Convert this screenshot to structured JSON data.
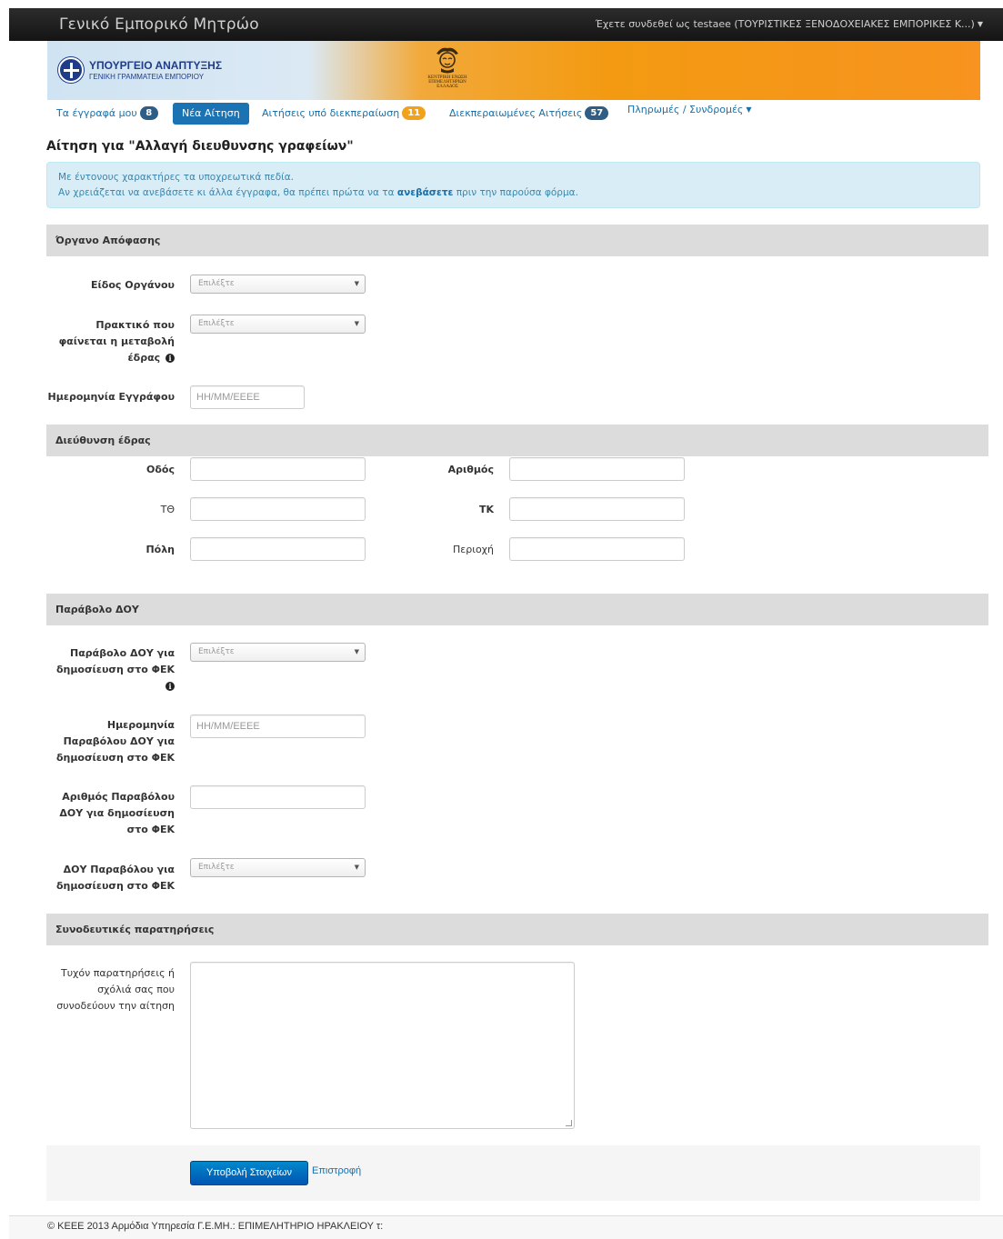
{
  "topbar": {
    "brand": "Γενικό Εμπορικό Μητρώο",
    "user": "Έχετε συνδεθεί ως testaee (ΤΟΥΡΙΣΤΙΚΕΣ ΞΕΝΟΔΟΧΕΙΑΚΕΣ ΕΜΠΟΡΙΚΕΣ Κ...)"
  },
  "banner": {
    "ministry_line1": "ΥΠΟΥΡΓΕΙΟ ΑΝΑΠΤΥΞΗΣ",
    "ministry_line2": "ΓΕΝΙΚΗ ΓΡΑΜΜΑΤΕΙΑ ΕΜΠΟΡΙΟΥ",
    "keee_line1": "ΚΕΝΤΡΙΚΗ ΕΝΩΣΗ",
    "keee_line2": "ΕΠΙΜΕΛΗΤΗΡΙΩΝ",
    "keee_line3": "ΕΛΛΑΔΟΣ"
  },
  "nav": {
    "my_docs": "Τα έγγραφά μου",
    "my_docs_count": "8",
    "new_request": "Νέα Αίτηση",
    "in_progress": "Αιτήσεις υπό διεκπεραίωση",
    "in_progress_count": "11",
    "completed": "Διεκπεραιωμένες Αιτήσεις",
    "completed_count": "57",
    "payments": "Πληρωμές / Συνδρομές"
  },
  "page": {
    "title": "Αίτηση για \"Αλλαγή διευθυνσης γραφείων\"",
    "alert_line1": "Με έντονους χαρακτήρες τα υποχρεωτικά πεδία.",
    "alert_line2_pre": "Αν χρειάζεται να ανεβάσετε κι άλλα έγγραφα, θα πρέπει πρώτα να τα ",
    "alert_link": "ανεβάσετε",
    "alert_line2_post": " πριν την παρούσα φόρμα."
  },
  "section_decision": {
    "header": "Όργανο Απόφασης",
    "organ_type_label": "Είδος Οργάνου",
    "organ_type_value": "Επιλέξτε",
    "minutes_label_1": "Πρακτικό που",
    "minutes_label_2": "φαίνεται η μεταβολή",
    "minutes_label_3": "έδρας",
    "minutes_value": "Επιλέξτε",
    "doc_date_label": "Ημερομηνία Εγγράφου",
    "doc_date_placeholder": "ΗΗ/ΜΜ/ΕΕΕΕ"
  },
  "section_address": {
    "header": "Διεύθυνση έδρας",
    "street_label": "Οδός",
    "number_label": "Αριθμός",
    "po_box_label": "ΤΘ",
    "postcode_label": "ΤΚ",
    "city_label": "Πόλη",
    "area_label": "Περιοχή"
  },
  "section_fee": {
    "header": "Παράβολο ΔΟΥ",
    "fee_label_1": "Παράβολο ΔΟΥ για",
    "fee_label_2": "δημοσίευση στο ΦΕΚ",
    "fee_value": "Επιλέξτε",
    "fee_date_label_1": "Ημερομηνία",
    "fee_date_label_2": "Παραβόλου ΔΟΥ για",
    "fee_date_label_3": "δημοσίευση στο ΦΕΚ",
    "fee_date_placeholder": "ΗΗ/ΜΜ/ΕΕΕΕ",
    "fee_number_label_1": "Αριθμός Παραβόλου",
    "fee_number_label_2": "ΔΟΥ για δημοσίευση",
    "fee_number_label_3": "στο ΦΕΚ",
    "fee_office_label_1": "ΔΟΥ Παραβόλου για",
    "fee_office_label_2": "δημοσίευση στο ΦΕΚ",
    "fee_office_value": "Επιλέξτε"
  },
  "section_notes": {
    "header": "Συνοδευτικές παρατηρήσεις",
    "notes_label_1": "Τυχόν παρατηρήσεις ή",
    "notes_label_2": "σχόλιά σας που",
    "notes_label_3": "συνοδεύουν την αίτηση"
  },
  "actions": {
    "submit": "Υποβολή Στοιχείων",
    "back": "Επιστροφή"
  },
  "footer": {
    "text": "© ΚΕΕΕ 2013 Αρμόδια Υπηρεσία Γ.Ε.ΜΗ.: ΕΠΙΜΕΛΗΤΗΡΙΟ ΗΡΑΚΛΕΙΟΥ τ:"
  },
  "icons": {
    "info": "info-icon",
    "caret": "caret-down-icon",
    "seal": "ministry-seal-icon",
    "hermes": "keee-hermes-logo"
  },
  "colors": {
    "topbar": "#1b1b1b",
    "banner_orange": "#f7931e",
    "nav_active": "#1b73b4",
    "badge_dark": "#2e5d86",
    "badge_orange": "#f0a21a",
    "alert_bg": "#d9edf7",
    "section_bg": "#dcdcdc",
    "primary_button": "#0066cc"
  }
}
